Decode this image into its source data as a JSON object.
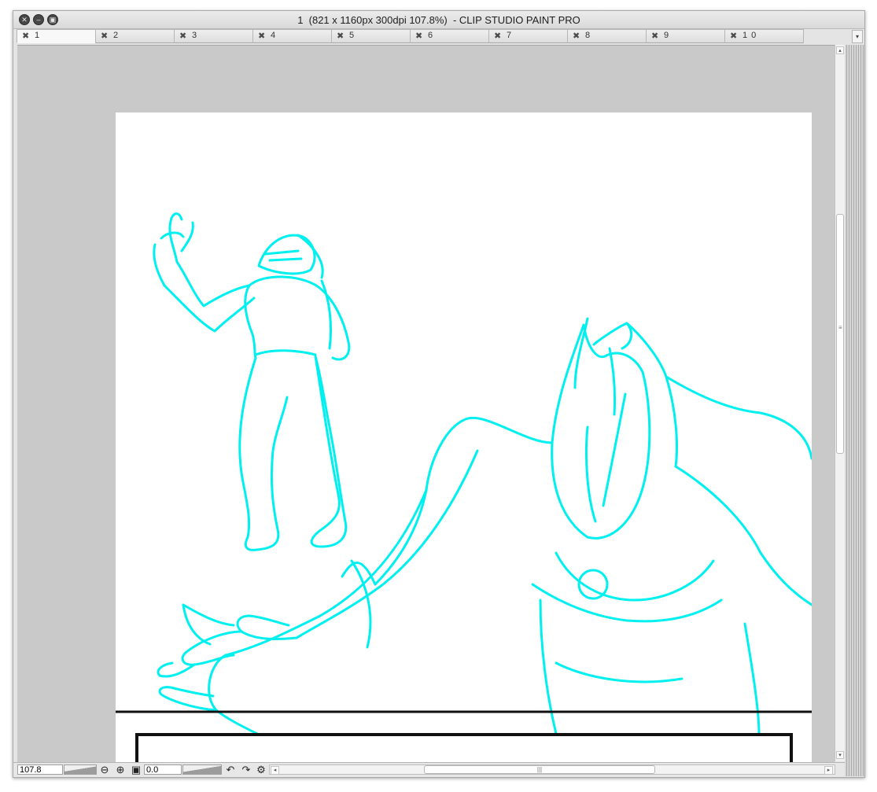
{
  "window": {
    "title": "1  (821 x 1160px 300dpi 107.8%)  - CLIP STUDIO PAINT PRO",
    "controls": {
      "close": "close-icon",
      "minimize": "minimize-icon",
      "zoom": "zoom-icon"
    }
  },
  "tabs": [
    {
      "label": "1",
      "active": true
    },
    {
      "label": "2"
    },
    {
      "label": "3"
    },
    {
      "label": "4"
    },
    {
      "label": "5"
    },
    {
      "label": "6"
    },
    {
      "label": "7"
    },
    {
      "label": "8"
    },
    {
      "label": "9"
    },
    {
      "label": "1 0"
    }
  ],
  "status_bar": {
    "zoom_value": "107.8",
    "rotation_value": "0.0",
    "icons": [
      "zoom-out-icon",
      "zoom-in-icon",
      "fit-screen-icon",
      "rotate-left-icon",
      "rotate-right-icon",
      "reset-view-icon"
    ]
  },
  "colors": {
    "sketch_stroke": "#00f0f0",
    "panel_border": "#111111",
    "canvas_background": "#c9c9c9"
  }
}
